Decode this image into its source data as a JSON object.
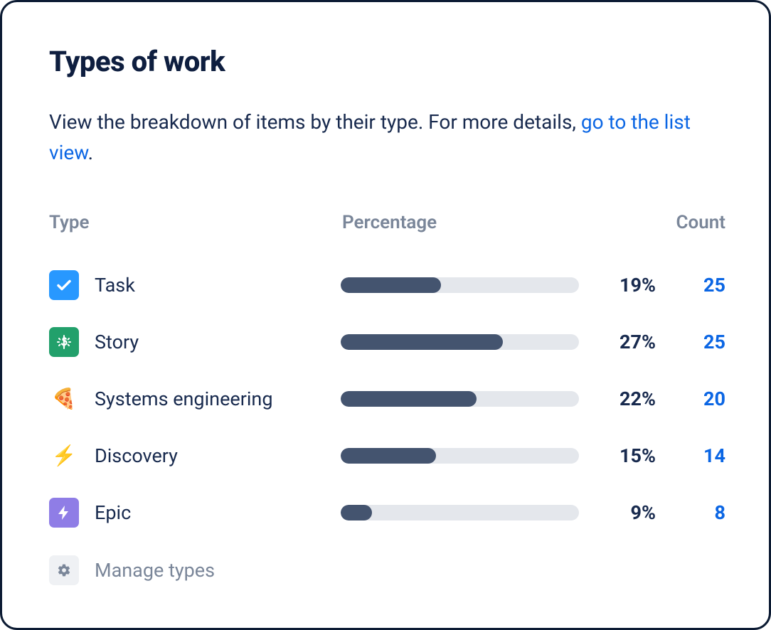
{
  "title": "Types of work",
  "subtitle_prefix": "View the breakdown of items by their type. For more details, ",
  "subtitle_link": "go to the list view",
  "subtitle_suffix": ".",
  "columns": {
    "type": "Type",
    "percentage": "Percentage",
    "count": "Count"
  },
  "rows": [
    {
      "icon": "task-icon",
      "label": "Task",
      "percentage": 19,
      "count": 25,
      "bar_pct": 42
    },
    {
      "icon": "story-icon",
      "label": "Story",
      "percentage": 27,
      "count": 25,
      "bar_pct": 68
    },
    {
      "icon": "pizza-icon",
      "label": "Systems engineering",
      "percentage": 22,
      "count": 20,
      "bar_pct": 57
    },
    {
      "icon": "lightning-icon",
      "label": "Discovery",
      "percentage": 15,
      "count": 14,
      "bar_pct": 40
    },
    {
      "icon": "epic-icon",
      "label": "Epic",
      "percentage": 9,
      "count": 8,
      "bar_pct": 13
    }
  ],
  "manage": {
    "label": "Manage types"
  },
  "chart_data": {
    "type": "bar",
    "title": "Types of work",
    "categories": [
      "Task",
      "Story",
      "Systems engineering",
      "Discovery",
      "Epic"
    ],
    "series": [
      {
        "name": "Percentage",
        "values": [
          19,
          27,
          22,
          15,
          9
        ]
      },
      {
        "name": "Count",
        "values": [
          25,
          25,
          20,
          14,
          8
        ]
      }
    ],
    "xlabel": "Type",
    "ylabel": "Percentage",
    "ylim": [
      0,
      100
    ]
  }
}
